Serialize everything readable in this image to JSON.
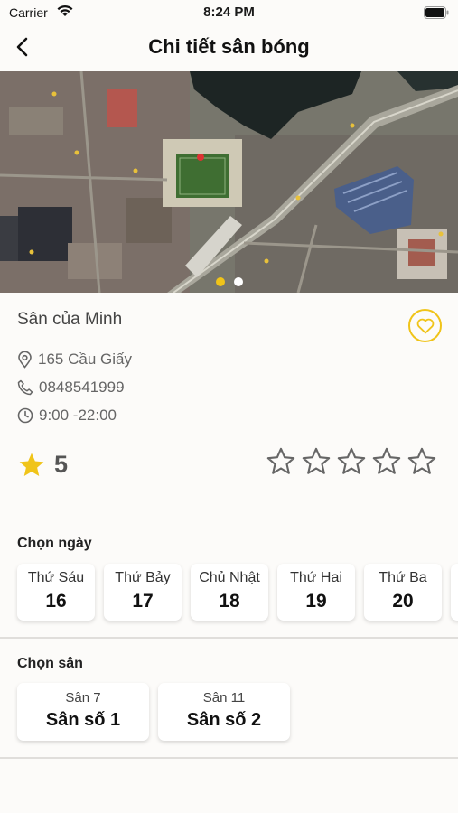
{
  "status_bar": {
    "carrier": "Carrier",
    "time": "8:24 PM"
  },
  "nav": {
    "title": "Chi tiết sân bóng"
  },
  "carousel": {
    "page_count": 2,
    "active_index": 0,
    "active_color": "#f0c419"
  },
  "venue": {
    "name": "Sân của Minh",
    "address": "165 Cầu Giấy",
    "phone": "0848541999",
    "hours": "9:00 -22:00",
    "rating": "5",
    "rate_stars_count": 5,
    "favorite_icon": "heart-icon"
  },
  "date_section": {
    "label": "Chọn ngày",
    "days": [
      {
        "name": "Thứ Sáu",
        "date": "16"
      },
      {
        "name": "Thứ Bảy",
        "date": "17"
      },
      {
        "name": "Chủ Nhật",
        "date": "18"
      },
      {
        "name": "Thứ Hai",
        "date": "19"
      },
      {
        "name": "Thứ Ba",
        "date": "20"
      }
    ]
  },
  "field_section": {
    "label": "Chọn sân",
    "fields": [
      {
        "type": "Sân 7",
        "name": "Sân số 1"
      },
      {
        "type": "Sân 11",
        "name": "Sân số 2"
      }
    ]
  },
  "colors": {
    "accent": "#f0c419",
    "background": "#fcfbf9"
  }
}
